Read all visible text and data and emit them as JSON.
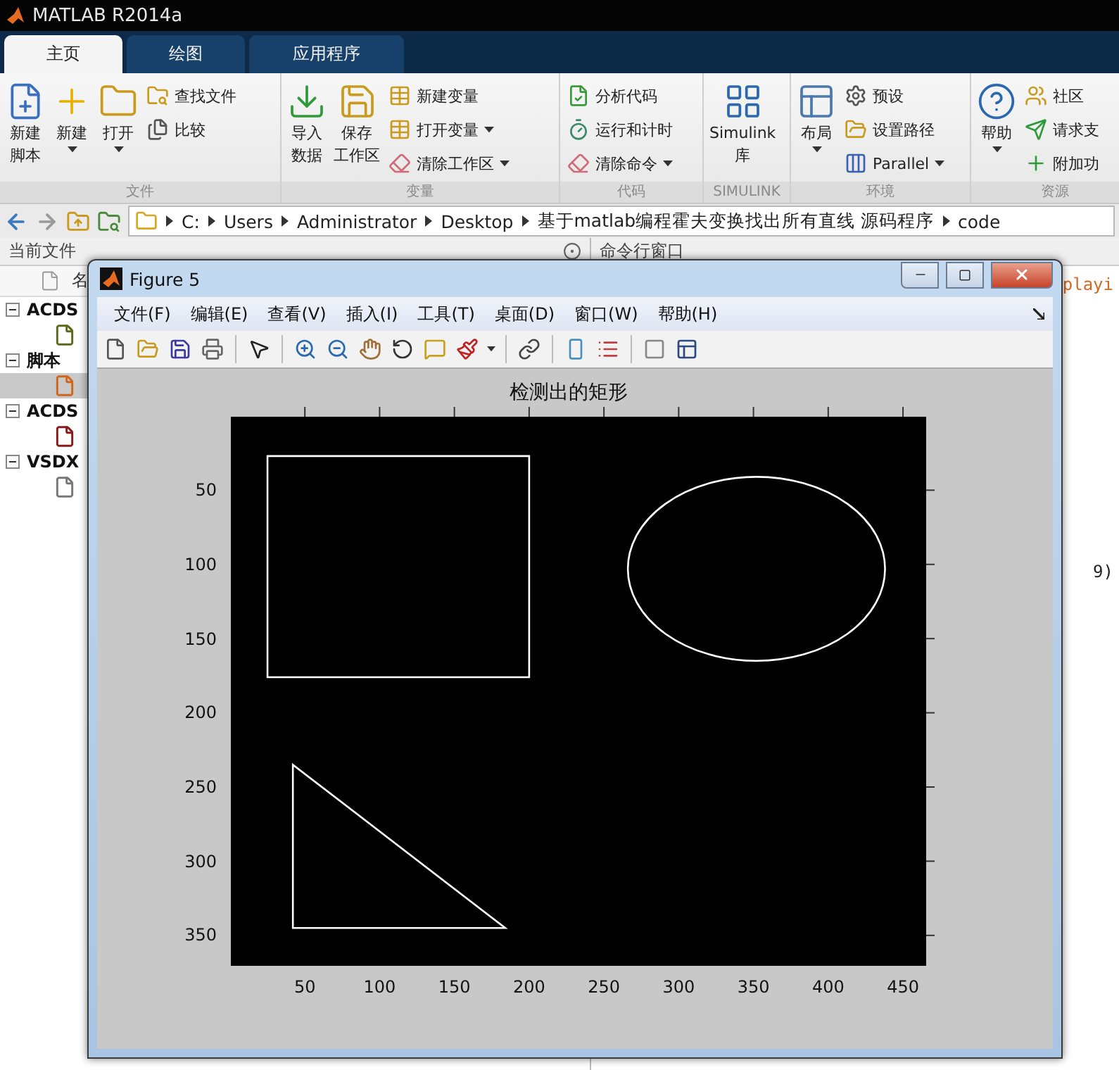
{
  "app_title": "MATLAB R2014a",
  "tabs": [
    {
      "label": "主页",
      "selected": true
    },
    {
      "label": "绘图",
      "selected": false
    },
    {
      "label": "应用程序",
      "selected": false
    }
  ],
  "ribbon": [
    {
      "label": "文件",
      "large": [
        {
          "lines": [
            "新建",
            "脚本"
          ],
          "dropdown": false
        },
        {
          "lines": [
            "新建"
          ],
          "dropdown": true
        },
        {
          "lines": [
            "打开"
          ],
          "dropdown": true
        }
      ],
      "small": [
        {
          "label": "查找文件",
          "dropdown": false
        },
        {
          "label": "比较",
          "dropdown": false
        }
      ]
    },
    {
      "label": "变量",
      "large": [
        {
          "lines": [
            "导入",
            "数据"
          ],
          "dropdown": false
        },
        {
          "lines": [
            "保存",
            "工作区"
          ],
          "dropdown": false
        }
      ],
      "small": [
        {
          "label": "新建变量",
          "dropdown": false
        },
        {
          "label": "打开变量",
          "dropdown": true
        },
        {
          "label": "清除工作区",
          "dropdown": true
        }
      ]
    },
    {
      "label": "代码",
      "small": [
        {
          "label": "分析代码",
          "dropdown": false
        },
        {
          "label": "运行和计时",
          "dropdown": false
        },
        {
          "label": "清除命令",
          "dropdown": true
        }
      ]
    },
    {
      "label": "SIMULINK",
      "large": [
        {
          "lines": [
            "Simulink",
            "库"
          ],
          "dropdown": false
        }
      ]
    },
    {
      "label": "环境",
      "large": [
        {
          "lines": [
            "布局"
          ],
          "dropdown": true
        }
      ],
      "small": [
        {
          "label": "预设",
          "dropdown": false
        },
        {
          "label": "设置路径",
          "dropdown": false
        },
        {
          "label": "Parallel",
          "dropdown": true
        }
      ]
    },
    {
      "label": "资源",
      "large": [
        {
          "lines": [
            "帮助"
          ],
          "dropdown": true
        }
      ],
      "small": [
        {
          "label": "社区",
          "dropdown": false
        },
        {
          "label": "请求支",
          "dropdown": false
        },
        {
          "label": "附加功",
          "dropdown": false
        }
      ]
    }
  ],
  "path": [
    "C:",
    "Users",
    "Administrator",
    "Desktop",
    "基于matlab编程霍夫变换找出所有直线 源码程序",
    "code"
  ],
  "current_folder": {
    "title": "当前文件",
    "column": "名",
    "tree": [
      {
        "label": "ACDS",
        "expanded": true,
        "children": [
          {
            "kind": "jpg",
            "selected": false
          }
        ]
      },
      {
        "label": "脚本",
        "expanded": true,
        "children": [
          {
            "kind": "mfile",
            "selected": true
          }
        ]
      },
      {
        "label": "ACDS",
        "expanded": true,
        "children": [
          {
            "kind": "png",
            "selected": false
          }
        ]
      },
      {
        "label": "VSDX",
        "expanded": true,
        "children": [
          {
            "kind": "doc",
            "selected": false
          }
        ]
      }
    ]
  },
  "command_window": {
    "title": "命令行窗口",
    "lines": [
      "playi",
      "9)"
    ]
  },
  "figure": {
    "title": "Figure 5",
    "menu": [
      "文件(F)",
      "编辑(E)",
      "查看(V)",
      "插入(I)",
      "工具(T)",
      "桌面(D)",
      "窗口(W)",
      "帮助(H)"
    ],
    "plot_title": "检测出的矩形",
    "xticks": [
      "50",
      "100",
      "150",
      "200",
      "250",
      "300",
      "350",
      "400",
      "450"
    ],
    "yticks": [
      "50",
      "100",
      "150",
      "200",
      "250",
      "300",
      "350"
    ]
  }
}
